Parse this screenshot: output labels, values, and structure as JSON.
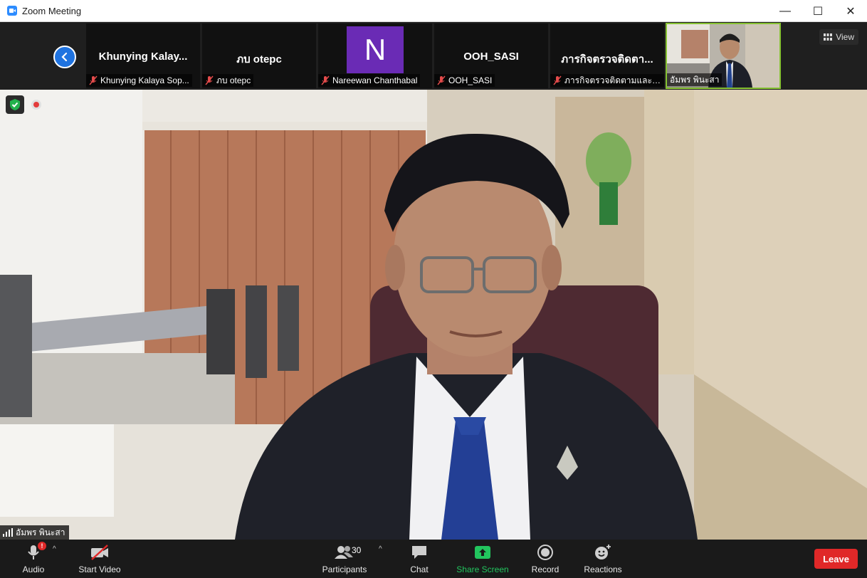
{
  "window": {
    "title": "Zoom Meeting",
    "minimize": "—",
    "maximize": "☐",
    "close": "✕"
  },
  "filmstrip": {
    "view_label": "View",
    "tiles": [
      {
        "display_name": "Khunying  Kalay...",
        "footer": "Khunying Kalaya Sop..."
      },
      {
        "display_name": "ภบ otepc",
        "footer": "ภบ otepc"
      },
      {
        "avatar_letter": "N",
        "footer": "Nareewan Chanthabal"
      },
      {
        "display_name": "OOH_SASI",
        "footer": "OOH_SASI"
      },
      {
        "display_name": "ภารกิจตรวจติดตา...",
        "footer": "ภารกิจตรวจติดตามและปร..."
      },
      {
        "footer": "อัมพร พินะสา"
      }
    ]
  },
  "main_video": {
    "speaker_name": "อัมพร พินะสา"
  },
  "toolbar": {
    "audio": "Audio",
    "audio_alert": "!",
    "video": "Start Video",
    "participants": "Participants",
    "participants_count": "30",
    "chat": "Chat",
    "share": "Share Screen",
    "record": "Record",
    "reactions": "Reactions",
    "leave": "Leave",
    "caret": "^"
  },
  "colors": {
    "share_green": "#22c55e",
    "leave_red": "#e02828",
    "self_border": "#86c232",
    "accent_blue": "#1f73e0"
  }
}
